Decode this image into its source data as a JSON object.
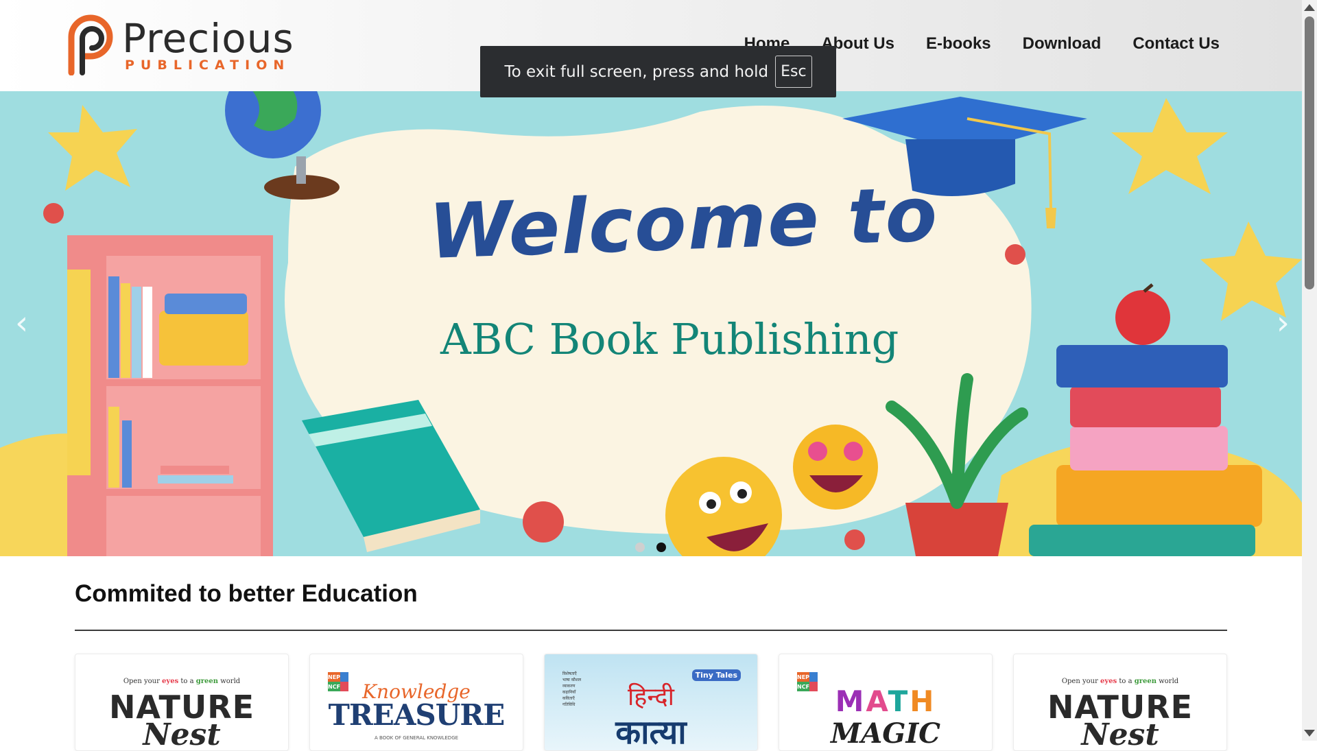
{
  "brand": {
    "name": "Precious",
    "tagline": "PUBLICATION",
    "colors": {
      "orange": "#e8662a",
      "dark": "#2b2b2b"
    }
  },
  "nav": {
    "items": [
      {
        "label": "Home"
      },
      {
        "label": "About Us"
      },
      {
        "label": "E-books"
      },
      {
        "label": "Download"
      },
      {
        "label": "Contact Us"
      }
    ]
  },
  "fullscreen_toast": {
    "text": "To exit full screen, press and hold",
    "key": "Esc"
  },
  "hero": {
    "title": "Welcome to",
    "subtitle": "ABC Book Publishing",
    "prev_icon": "‹",
    "next_icon": "›",
    "slides_total": 2,
    "active_slide": 2,
    "colors": {
      "title": "#274e96",
      "subtitle": "#138577",
      "sky": "#9fdde0",
      "blob": "#fbf4e2"
    }
  },
  "section": {
    "title": "Commited to better Education"
  },
  "books": [
    {
      "tagline_parts": [
        "Open your ",
        "eyes",
        " to a ",
        "green",
        " world"
      ],
      "title": "NATURE",
      "script": "Nest"
    },
    {
      "badge": [
        "NEP",
        "NCF"
      ],
      "script": "Knowledge",
      "title": "TREASURE",
      "small": "A BOOK OF GENERAL KNOWLEDGE"
    },
    {
      "title": "हिन्दी",
      "subtitle": "कात्या",
      "badge": "Tiny Tales",
      "list": [
        "विशेषताएँ",
        "भाषा कौशल",
        "व्याकरण",
        "कहानियाँ",
        "कविताएँ",
        "गतिविधि"
      ]
    },
    {
      "badge": [
        "NEP",
        "NCF"
      ],
      "title_letters": [
        "M",
        "A",
        "T",
        "H"
      ],
      "script": "MAGIC"
    },
    {
      "tagline_parts": [
        "Open your ",
        "eyes",
        " to a ",
        "green",
        " world"
      ],
      "title": "NATURE",
      "script": "Nest"
    }
  ]
}
